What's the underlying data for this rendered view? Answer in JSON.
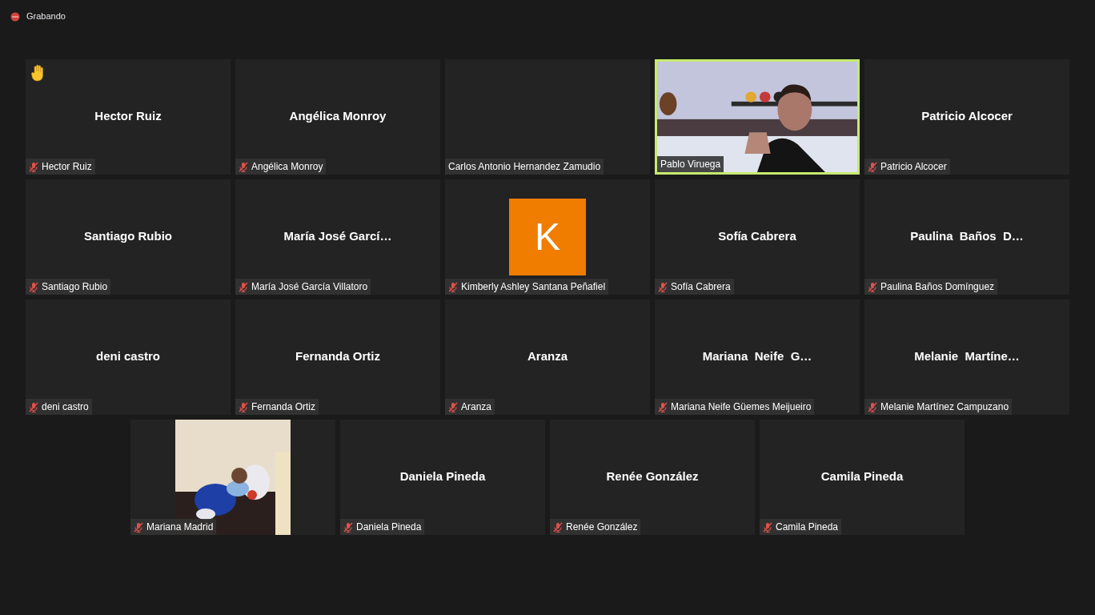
{
  "recording": {
    "label": "Grabando"
  },
  "rows": [
    [
      {
        "kind": "name",
        "display_name": "Hector Ruiz",
        "label": "Hector Ruiz",
        "muted": true,
        "hand_raised": true,
        "speaking": false
      },
      {
        "kind": "name",
        "display_name": "Angélica Monroy",
        "label": "Angélica Monroy",
        "muted": true,
        "hand_raised": false,
        "speaking": false
      },
      {
        "kind": "blank",
        "label": "Carlos Antonio Hernandez Zamudio",
        "muted": false,
        "hand_raised": false,
        "speaking": false
      },
      {
        "kind": "video",
        "label": "Pablo Viruega",
        "muted": false,
        "hand_raised": false,
        "speaking": true
      },
      {
        "kind": "name",
        "display_name": "Patricio Alcocer",
        "label": "Patricio Alcocer",
        "muted": true,
        "hand_raised": false,
        "speaking": false
      }
    ],
    [
      {
        "kind": "name",
        "display_name": "Santiago Rubio",
        "label": "Santiago Rubio",
        "muted": true,
        "hand_raised": false,
        "speaking": false
      },
      {
        "kind": "name",
        "display_name": "María José Garcí…",
        "label": "María José García Villatoro",
        "muted": true,
        "hand_raised": false,
        "speaking": false
      },
      {
        "kind": "avatar",
        "initial": "K",
        "color": "#f07c00",
        "label": "Kimberly Ashley Santana Peñafiel",
        "muted": true,
        "hand_raised": false,
        "speaking": false
      },
      {
        "kind": "name",
        "display_name": "Sofía Cabrera",
        "label": "Sofía Cabrera",
        "muted": true,
        "hand_raised": false,
        "speaking": false
      },
      {
        "kind": "name",
        "display_name": "Paulina  Baños  D…",
        "label": "Paulina Baños Domínguez",
        "muted": true,
        "hand_raised": false,
        "speaking": false
      }
    ],
    [
      {
        "kind": "name",
        "display_name": "deni castro",
        "label": "deni castro",
        "muted": true,
        "hand_raised": false,
        "speaking": false
      },
      {
        "kind": "name",
        "display_name": "Fernanda Ortiz",
        "label": "Fernanda Ortiz",
        "muted": true,
        "hand_raised": false,
        "speaking": false
      },
      {
        "kind": "name",
        "display_name": "Aranza",
        "label": "Aranza",
        "muted": true,
        "hand_raised": false,
        "speaking": false
      },
      {
        "kind": "name",
        "display_name": "Mariana  Neife  G…",
        "label": "Mariana Neife Güemes Meijueiro",
        "muted": true,
        "hand_raised": false,
        "speaking": false
      },
      {
        "kind": "name",
        "display_name": "Melanie  Martíne…",
        "label": "Melanie Martínez Campuzano",
        "muted": true,
        "hand_raised": false,
        "speaking": false
      }
    ],
    [
      {
        "label": "Mariana Madrid",
        "muted": true,
        "hand_raised": false,
        "speaking": false
      },
      {
        "kind": "name",
        "display_name": "Daniela Pineda",
        "label": "Daniela Pineda",
        "muted": true,
        "hand_raised": false,
        "speaking": false
      },
      {
        "kind": "name",
        "display_name": "Renée González",
        "label": "Renée González",
        "muted": true,
        "hand_raised": false,
        "speaking": false
      },
      {
        "kind": "name",
        "display_name": "Camila Pineda",
        "label": "Camila Pineda",
        "muted": true,
        "hand_raised": false,
        "speaking": false
      }
    ]
  ]
}
